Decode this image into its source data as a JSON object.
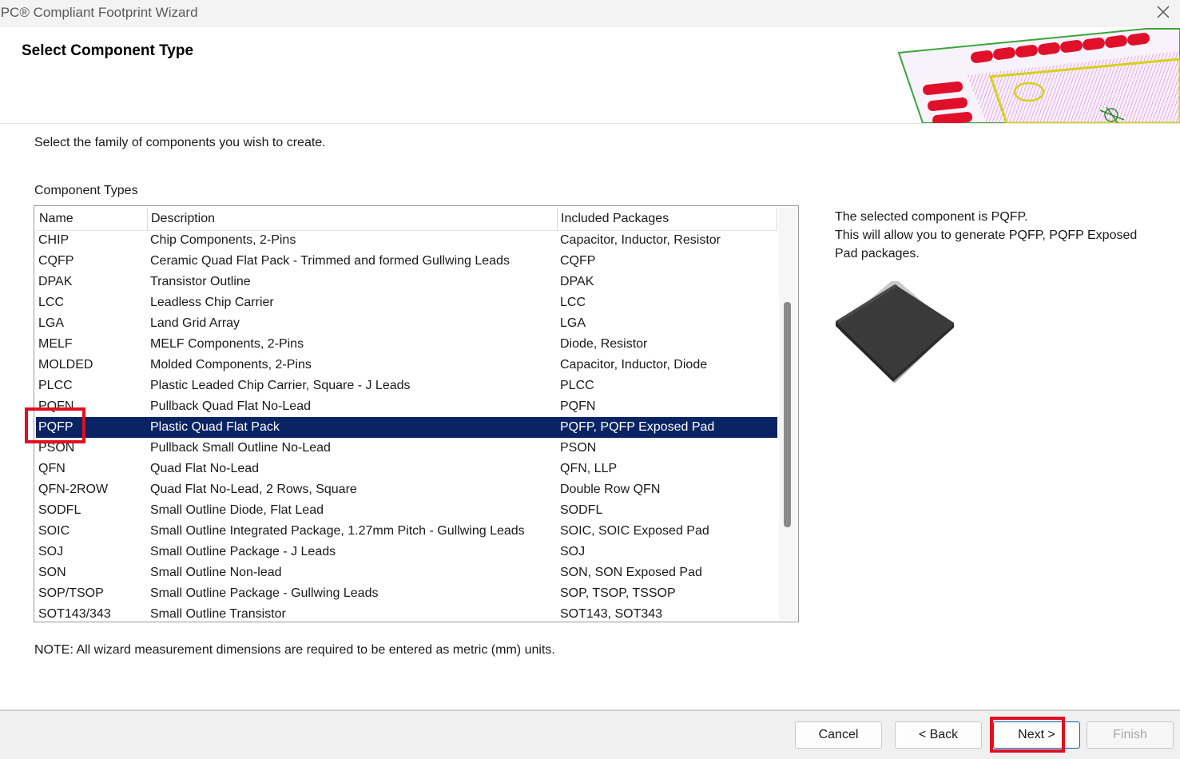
{
  "window": {
    "title": "IPC® Compliant Footprint Wizard"
  },
  "header": {
    "title": "Select Component Type"
  },
  "instruction": "Select the family of components you wish to create.",
  "component_types_label": "Component Types",
  "columns": [
    "Name",
    "Description",
    "Included Packages"
  ],
  "rows": [
    {
      "name": "CHIP",
      "description": "Chip Components, 2-Pins",
      "packages": "Capacitor, Inductor, Resistor"
    },
    {
      "name": "CQFP",
      "description": "Ceramic Quad Flat Pack - Trimmed and formed Gullwing Leads",
      "packages": "CQFP"
    },
    {
      "name": "DPAK",
      "description": "Transistor Outline",
      "packages": "DPAK"
    },
    {
      "name": "LCC",
      "description": "Leadless Chip Carrier",
      "packages": "LCC"
    },
    {
      "name": "LGA",
      "description": "Land Grid Array",
      "packages": "LGA"
    },
    {
      "name": "MELF",
      "description": "MELF Components, 2-Pins",
      "packages": "Diode, Resistor"
    },
    {
      "name": "MOLDED",
      "description": "Molded Components, 2-Pins",
      "packages": "Capacitor, Inductor, Diode"
    },
    {
      "name": "PLCC",
      "description": "Plastic Leaded Chip Carrier, Square - J Leads",
      "packages": "PLCC"
    },
    {
      "name": "PQFN",
      "description": "Pullback Quad Flat No-Lead",
      "packages": "PQFN"
    },
    {
      "name": "PQFP",
      "description": "Plastic Quad Flat Pack",
      "packages": "PQFP, PQFP Exposed Pad"
    },
    {
      "name": "PSON",
      "description": "Pullback Small Outline No-Lead",
      "packages": "PSON"
    },
    {
      "name": "QFN",
      "description": "Quad Flat No-Lead",
      "packages": "QFN, LLP"
    },
    {
      "name": "QFN-2ROW",
      "description": "Quad Flat No-Lead, 2 Rows, Square",
      "packages": "Double Row QFN"
    },
    {
      "name": "SODFL",
      "description": "Small Outline Diode, Flat Lead",
      "packages": "SODFL"
    },
    {
      "name": "SOIC",
      "description": "Small Outline Integrated Package, 1.27mm Pitch - Gullwing Leads",
      "packages": "SOIC, SOIC Exposed Pad"
    },
    {
      "name": "SOJ",
      "description": "Small Outline Package - J Leads",
      "packages": "SOJ"
    },
    {
      "name": "SON",
      "description": "Small Outline Non-lead",
      "packages": "SON, SON Exposed Pad"
    },
    {
      "name": "SOP/TSOP",
      "description": "Small Outline Package - Gullwing Leads",
      "packages": "SOP, TSOP, TSSOP"
    },
    {
      "name": "SOT143/343",
      "description": "Small Outline Transistor",
      "packages": "SOT143, SOT343"
    }
  ],
  "selected_index": 9,
  "info": {
    "line1": "The selected component is PQFP.",
    "line2": "This will allow you to generate PQFP, PQFP Exposed Pad packages."
  },
  "note": "NOTE: All wizard measurement dimensions are required to be entered as metric (mm) units.",
  "buttons": {
    "cancel": "Cancel",
    "back": "< Back",
    "next": "Next >",
    "finish": "Finish"
  },
  "colors": {
    "selection": "#0a2463",
    "highlight": "#e01020"
  },
  "icons": [
    "close-icon",
    "footprint-banner-image",
    "pqfp-chip-image"
  ]
}
